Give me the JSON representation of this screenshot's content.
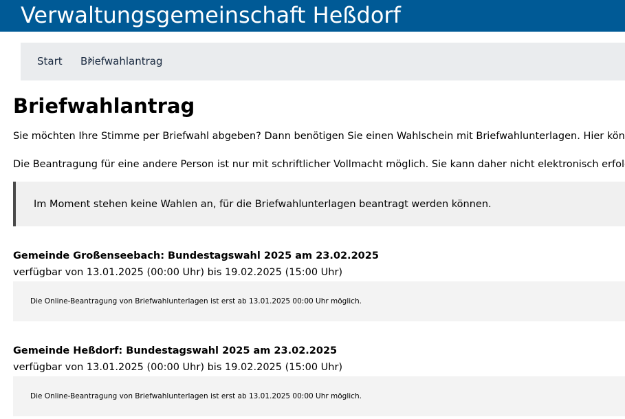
{
  "header": {
    "title": "Verwaltungsgemeinschaft Heßdorf"
  },
  "breadcrumb": {
    "items": [
      {
        "label": "Start"
      },
      {
        "label": "Briefwahlantrag"
      }
    ]
  },
  "main": {
    "title": "Briefwahlantrag",
    "intro": [
      "Sie möchten Ihre Stimme per Briefwahl abgeben? Dann benötigen Sie einen Wahlschein mit Briefwahlunterlagen. Hier können",
      "Die Beantragung für eine andere Person ist nur mit schriftlicher Vollmacht möglich. Sie kann daher nicht elektronisch erfolgen."
    ],
    "notice": "Im Moment stehen keine Wahlen an, für die Briefwahlunterlagen beantragt werden können.",
    "elections": [
      {
        "title": "Gemeinde Großenseebach: Bundestagswahl 2025 am 23.02.2025",
        "period": "verfügbar von 13.01.2025 (00:00 Uhr) bis 19.02.2025 (15:00 Uhr)",
        "info": "Die Online-Beantragung von Briefwahlunterlagen ist erst ab 13.01.2025 00:00 Uhr möglich."
      },
      {
        "title": "Gemeinde Heßdorf: Bundestagswahl 2025 am 23.02.2025",
        "period": "verfügbar von 13.01.2025 (00:00 Uhr) bis 19.02.2025 (15:00 Uhr)",
        "info": "Die Online-Beantragung von Briefwahlunterlagen ist erst ab 13.01.2025 00:00 Uhr möglich."
      }
    ]
  },
  "colors": {
    "header_bg": "#005a96",
    "breadcrumb_bg": "#eaecee",
    "notice_bg": "#f0f0f0",
    "notice_border": "#4a4a4a",
    "info_box_bg": "#f3f3f3"
  }
}
